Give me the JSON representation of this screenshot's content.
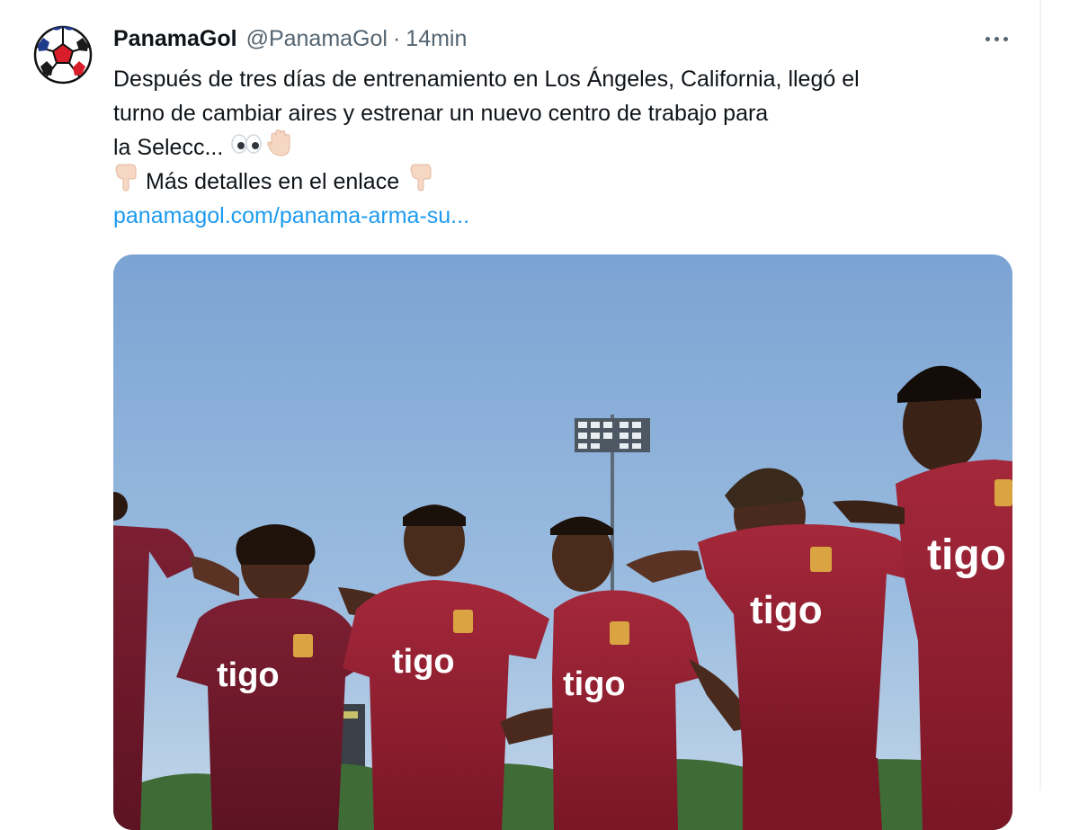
{
  "tweet": {
    "author": {
      "display_name": "PanamaGol",
      "handle": "@PanamaGol",
      "avatar_icon": "soccer-ball-icon"
    },
    "separator": "·",
    "time": "14min",
    "more_icon": "more-dots-icon",
    "text_lines": [
      "Después de tres días de entrenamiento en Los Ángeles, California, llegó el",
      "turno de cambiar aires y estrenar un nuevo centro de trabajo para",
      "la Selecc..."
    ],
    "line4_text": "Más detalles en el enlace",
    "emojis": {
      "eyes": "eyes-emoji",
      "hand": "raised-hand-emoji",
      "point_down": "backhand-index-pointing-down-emoji"
    },
    "link_text": "panamagol.com/panama-arma-su...",
    "media": {
      "jersey_sponsor": "tigo",
      "jersey_color": "#8c1c2c",
      "sky_color": "#7fa6d2"
    }
  }
}
